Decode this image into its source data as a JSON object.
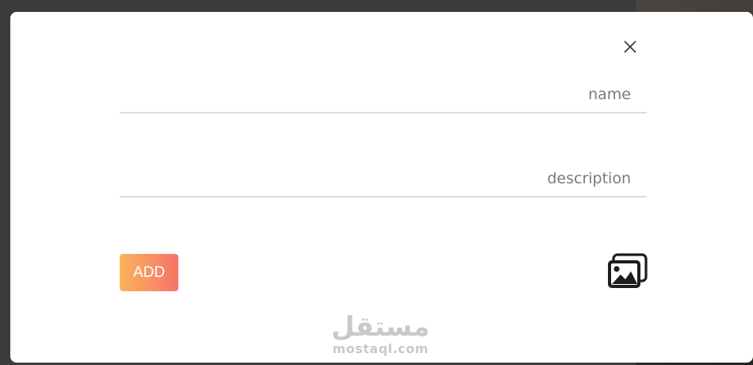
{
  "modal": {
    "close_icon": "close-icon",
    "fields": {
      "name_placeholder": "name",
      "description_placeholder": "description"
    },
    "add_label": "ADD",
    "image_icon": "images-icon",
    "accent_gradient": [
      "#fbb35c",
      "#f5736a"
    ]
  },
  "watermark": {
    "arabic": "مستقل",
    "latin": "mostaql.com"
  }
}
